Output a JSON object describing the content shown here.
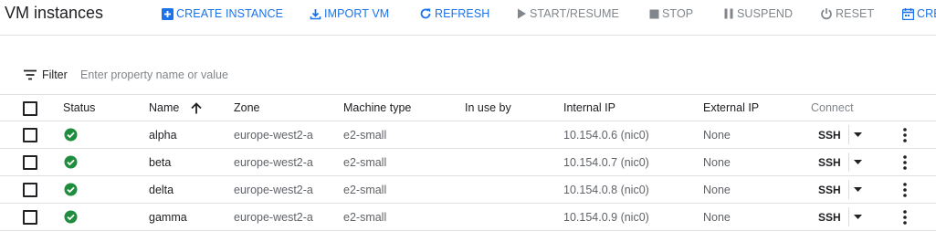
{
  "page": {
    "title": "VM instances"
  },
  "toolbar": {
    "create_instance": "CREATE INSTANCE",
    "import_vm": "IMPORT VM",
    "refresh": "REFRESH",
    "start_resume": "START/RESUME",
    "stop": "STOP",
    "suspend": "SUSPEND",
    "reset": "RESET",
    "create_partial": "CRE"
  },
  "filter": {
    "label": "Filter",
    "placeholder": "Enter property name or value"
  },
  "table": {
    "columns": {
      "status": "Status",
      "name": "Name",
      "zone": "Zone",
      "machine_type": "Machine type",
      "in_use_by": "In use by",
      "internal_ip": "Internal IP",
      "external_ip": "External IP",
      "connect": "Connect"
    },
    "sort": {
      "column": "Name",
      "direction": "ascending"
    },
    "rows": [
      {
        "status": "running",
        "name": "alpha",
        "zone": "europe-west2-a",
        "machine_type": "e2-small",
        "in_use_by": "",
        "internal_ip": "10.154.0.6",
        "nic": "nic0",
        "external_ip": "None",
        "connect": "SSH"
      },
      {
        "status": "running",
        "name": "beta",
        "zone": "europe-west2-a",
        "machine_type": "e2-small",
        "in_use_by": "",
        "internal_ip": "10.154.0.7",
        "nic": "nic0",
        "external_ip": "None",
        "connect": "SSH"
      },
      {
        "status": "running",
        "name": "delta",
        "zone": "europe-west2-a",
        "machine_type": "e2-small",
        "in_use_by": "",
        "internal_ip": "10.154.0.8",
        "nic": "nic0",
        "external_ip": "None",
        "connect": "SSH"
      },
      {
        "status": "running",
        "name": "gamma",
        "zone": "europe-west2-a",
        "machine_type": "e2-small",
        "in_use_by": "",
        "internal_ip": "10.154.0.9",
        "nic": "nic0",
        "external_ip": "None",
        "connect": "SSH"
      }
    ]
  },
  "colors": {
    "accent": "#1a73e8",
    "status_ok": "#1e8e3e",
    "disabled": "#80868b"
  },
  "icons": {
    "create_instance": "add-box-icon",
    "import_vm": "download-icon",
    "refresh": "refresh-icon",
    "start_resume": "play-icon",
    "stop": "stop-icon",
    "suspend": "pause-icon",
    "reset": "power-icon",
    "create_partial": "calendar-icon",
    "filter": "filter-list-icon",
    "sort": "arrow-up-icon",
    "status": "check-circle-icon",
    "connect_menu": "caret-down-icon",
    "row_menu": "more-vert-icon"
  }
}
